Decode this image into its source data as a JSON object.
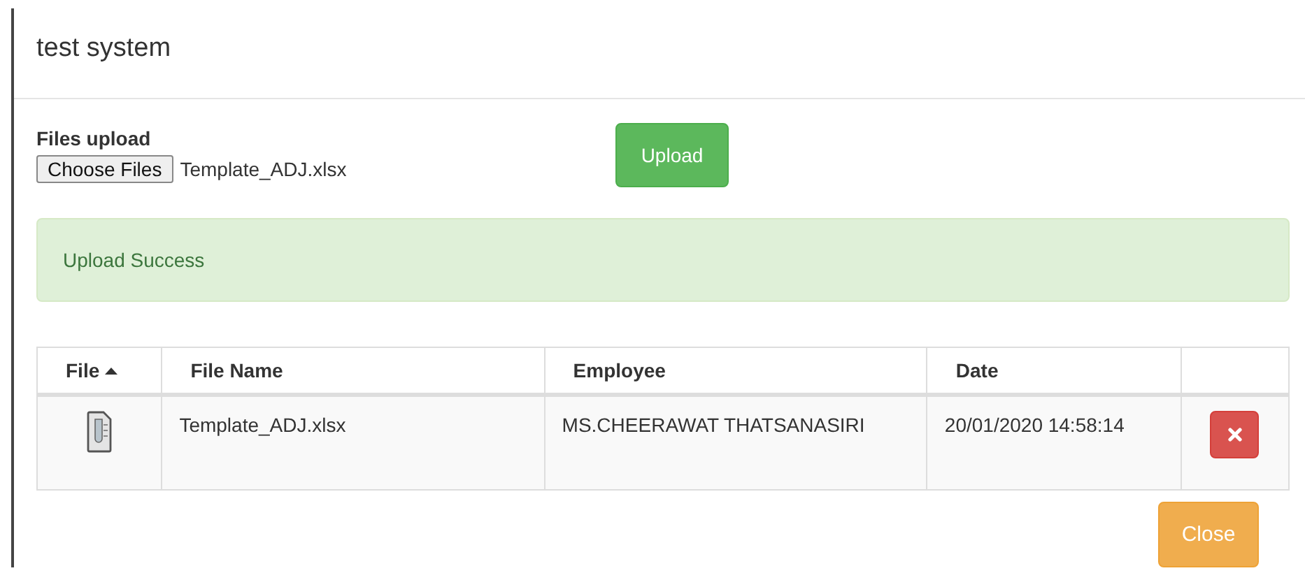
{
  "dialog": {
    "title": "test system"
  },
  "upload": {
    "label": "Files upload",
    "choose_button": "Choose Files",
    "chosen_file": "Template_ADJ.xlsx",
    "upload_button": "Upload"
  },
  "alert": {
    "kind": "success",
    "text": "Upload Success"
  },
  "table": {
    "columns": [
      {
        "label": "File",
        "sorted": true
      },
      {
        "label": "File Name",
        "sorted": false
      },
      {
        "label": "Employee",
        "sorted": false
      },
      {
        "label": "Date",
        "sorted": false
      }
    ],
    "rows": [
      {
        "file_name": "Template_ADJ.xlsx",
        "employee": "MS.CHEERAWAT THATSANASIRI",
        "date": "20/01/2020 14:58:14"
      }
    ]
  },
  "footer": {
    "close_button": "Close"
  }
}
